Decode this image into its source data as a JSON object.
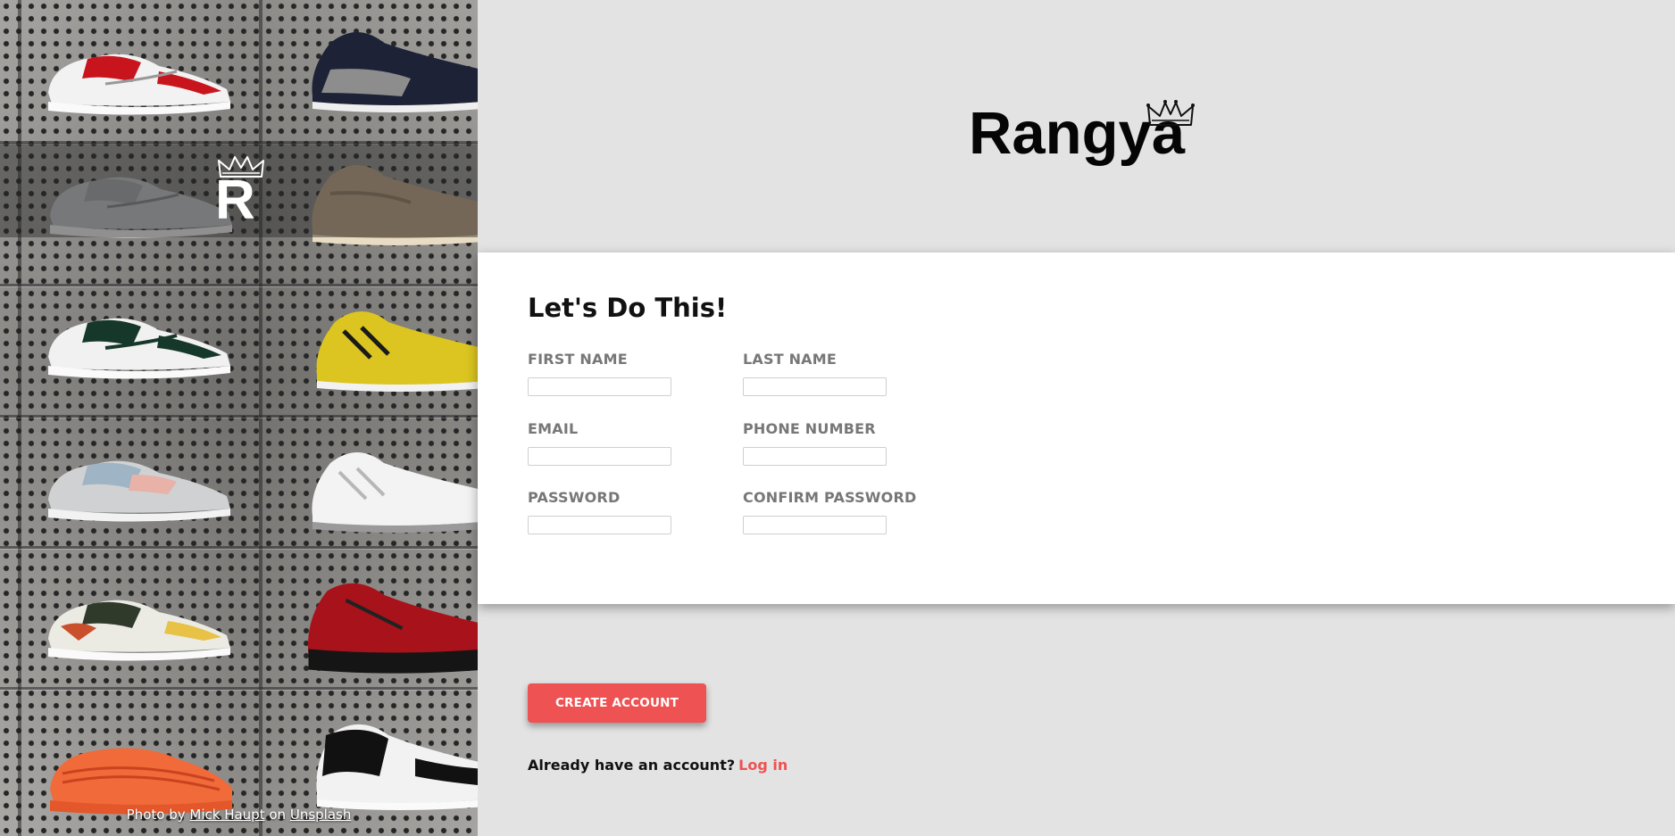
{
  "photo": {
    "logo_letter": "R",
    "credit": {
      "prefix": "Photo by",
      "author": "Mick Haupt",
      "on": "on",
      "site": "Unsplash"
    }
  },
  "brand": {
    "wordmark": "Rangya",
    "crown_icon": "crown-icon"
  },
  "form": {
    "heading": "Let's Do This!",
    "fields": {
      "first_name": {
        "label": "FIRST NAME",
        "value": ""
      },
      "last_name": {
        "label": "LAST NAME",
        "value": ""
      },
      "email": {
        "label": "EMAIL",
        "value": ""
      },
      "phone": {
        "label": "PHONE NUMBER",
        "value": ""
      },
      "password": {
        "label": "PASSWORD",
        "value": ""
      },
      "confirm_password": {
        "label": "CONFIRM PASSWORD",
        "value": ""
      }
    }
  },
  "actions": {
    "create_label": "CREATE ACCOUNT",
    "login_prompt": "Already have an account?",
    "login_link": "Log in"
  },
  "colors": {
    "accent": "#ee5252",
    "background": "#e3e3e3",
    "card": "#ffffff",
    "label": "#777777"
  }
}
